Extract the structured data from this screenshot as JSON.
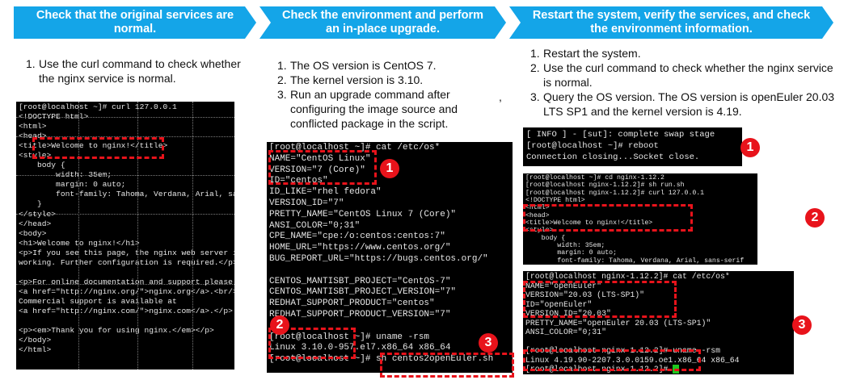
{
  "headers": {
    "col1": "Check that the original services are normal.",
    "col2": "Check the environment and perform an in-place upgrade.",
    "col3": "Restart the system, verify the services, and check the environment information."
  },
  "steps": {
    "col1": [
      {
        "num": "1.",
        "text": "Use the curl command to check whether the nginx service is normal."
      }
    ],
    "col2": [
      {
        "num": "1.",
        "text": "The OS version is CentOS 7."
      },
      {
        "num": "2.",
        "text": "The kernel version is 3.10."
      },
      {
        "num": "3.",
        "text": "Run an upgrade command after configuring the image source and conflicted package in the script."
      }
    ],
    "col3": [
      {
        "num": "1.",
        "text": "Restart the system."
      },
      {
        "num": "2.",
        "text": "Use the curl command to check whether the nginx service is normal."
      },
      {
        "num": "3.",
        "text": "Query the OS version. The OS version is openEuler 20.03 LTS SP1 and the kernel version is 4.19."
      }
    ]
  },
  "stray_mark": ",",
  "terminal_curl_before": [
    "[root@localhost ~]# curl 127.0.0.1",
    "<!DOCTYPE html>",
    "<html>",
    "<head>",
    "<title>Welcome to nginx!</title>",
    "<style>",
    "    body {",
    "        width: 35em;",
    "        margin: 0 auto;",
    "        font-family: Tahoma, Verdana, Arial, sa",
    "    }",
    "</style>",
    "</head>",
    "<body>",
    "<h1>Welcome to nginx!</h1>",
    "<p>If you see this page, the nginx web server i",
    "working. Further configuration is required.</p>",
    "",
    "<p>For online documentation and support please",
    "<a href=\"http://nginx.org/\">nginx.org</a>.<br/>",
    "Commercial support is available at",
    "<a href=\"http://nginx.com/\">nginx.com</a>.</p>",
    "",
    "<p><em>Thank you for using nginx.</em></p>",
    "</body>",
    "</html>"
  ],
  "terminal_centos": [
    "[root@localhost ~]# cat /etc/os*",
    "NAME=\"CentOS Linux\"",
    "VERSION=\"7 (Core)\"",
    "ID=\"centos\"",
    "ID_LIKE=\"rhel fedora\"",
    "VERSION_ID=\"7\"",
    "PRETTY_NAME=\"CentOS Linux 7 (Core)\"",
    "ANSI_COLOR=\"0;31\"",
    "CPE_NAME=\"cpe:/o:centos:centos:7\"",
    "HOME_URL=\"https://www.centos.org/\"",
    "BUG_REPORT_URL=\"https://bugs.centos.org/\"",
    "",
    "CENTOS_MANTISBT_PROJECT=\"CentOS-7\"",
    "CENTOS_MANTISBT_PROJECT_VERSION=\"7\"",
    "REDHAT_SUPPORT_PRODUCT=\"centos\"",
    "REDHAT_SUPPORT_PRODUCT_VERSION=\"7\"",
    "",
    "[root@localhost ~]# uname -rsm",
    "Linux 3.10.0-957.el7.x86_64 x86_64",
    "[root@localhost ~]# sh centos2openEuler.sh"
  ],
  "terminal_reboot": [
    "[ INFO ] - [sut]: complete swap stage",
    "[root@localhost ~]# reboot",
    "Connection closing...Socket close."
  ],
  "terminal_curl_after": [
    "[root@localhost ~]# cd nginx-1.12.2",
    "[root@localhost nginx-1.12.2]# sh run.sh",
    "[root@localhost nginx-1.12.2]# curl 127.0.0.1",
    "<!DOCTYPE html>",
    "<html>",
    "<head>",
    "<title>Welcome to nginx!</title>",
    "<style>",
    "    body {",
    "        width: 35em;",
    "        margin: 0 auto;",
    "        font-family: Tahoma, Verdana, Arial, sans-serif"
  ],
  "terminal_openeuler": [
    "[root@localhost nginx-1.12.2]# cat /etc/os*",
    "NAME=\"openEuler\"",
    "VERSION=\"20.03 (LTS-SP1)\"",
    "ID=\"openEuler\"",
    "VERSION_ID=\"20.03\"",
    "PRETTY_NAME=\"openEuler 20.03 (LTS-SP1)\"",
    "ANSI_COLOR=\"0;31\"",
    "",
    "[root@localhost nginx-1.12.2]# uname -rsm",
    "Linux 4.19.90-2207.3.0.0159.oe1.x86_64 x86_64",
    "[root@localhost nginx-1.12.2]# "
  ],
  "badges": {
    "one": "1",
    "two": "2",
    "three": "3"
  },
  "colors": {
    "arrow": "#14a5e8",
    "highlight": "#e8131b",
    "terminal_bg": "#000000",
    "cursor": "#1ec81e"
  }
}
